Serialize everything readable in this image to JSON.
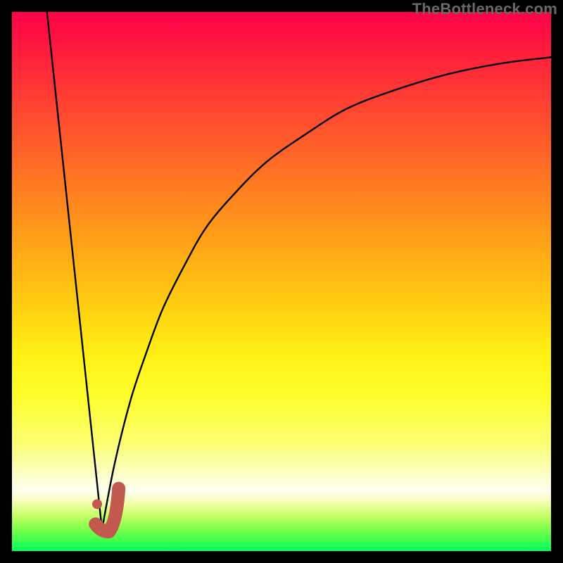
{
  "watermark": "TheBottleneck.com",
  "colors": {
    "curve": "#000000",
    "marker": "#c1594e",
    "background_frame": "#000000"
  },
  "chart_data": {
    "type": "line",
    "title": "",
    "xlabel": "",
    "ylabel": "",
    "xlim": [
      0,
      100
    ],
    "ylim": [
      0,
      100
    ],
    "grid": false,
    "note": "No tick labels or axis text are visible in the image; values are estimated from pixel positions.",
    "series": [
      {
        "name": "left-line",
        "x": [
          6.5,
          16.7
        ],
        "y": [
          100,
          4
        ]
      },
      {
        "name": "right-curve",
        "x": [
          16.7,
          19,
          22,
          25,
          28,
          32,
          36,
          41,
          47,
          54,
          62,
          71,
          81,
          91,
          100
        ],
        "y": [
          4,
          16,
          28,
          37,
          45,
          53,
          60,
          66,
          72,
          77,
          82,
          85.5,
          88.5,
          90.5,
          91.6
        ]
      }
    ],
    "marker": {
      "name": "j-marker",
      "description": "J-shaped tick marker near curve minimum",
      "dot": {
        "x": 15.8,
        "y": 8.7
      },
      "path": [
        {
          "x": 15.5,
          "y": 5.0
        },
        {
          "x": 16.5,
          "y": 3.6
        },
        {
          "x": 18.0,
          "y": 3.6
        },
        {
          "x": 19.4,
          "y": 5.4
        },
        {
          "x": 19.8,
          "y": 11.6
        }
      ]
    },
    "gradient_stops": [
      {
        "pos": 0,
        "color": "#ff0048"
      },
      {
        "pos": 50,
        "color": "#ffc812"
      },
      {
        "pos": 75,
        "color": "#fdff4a"
      },
      {
        "pos": 90,
        "color": "#f8ffc8"
      },
      {
        "pos": 100,
        "color": "#05ff67"
      }
    ]
  }
}
